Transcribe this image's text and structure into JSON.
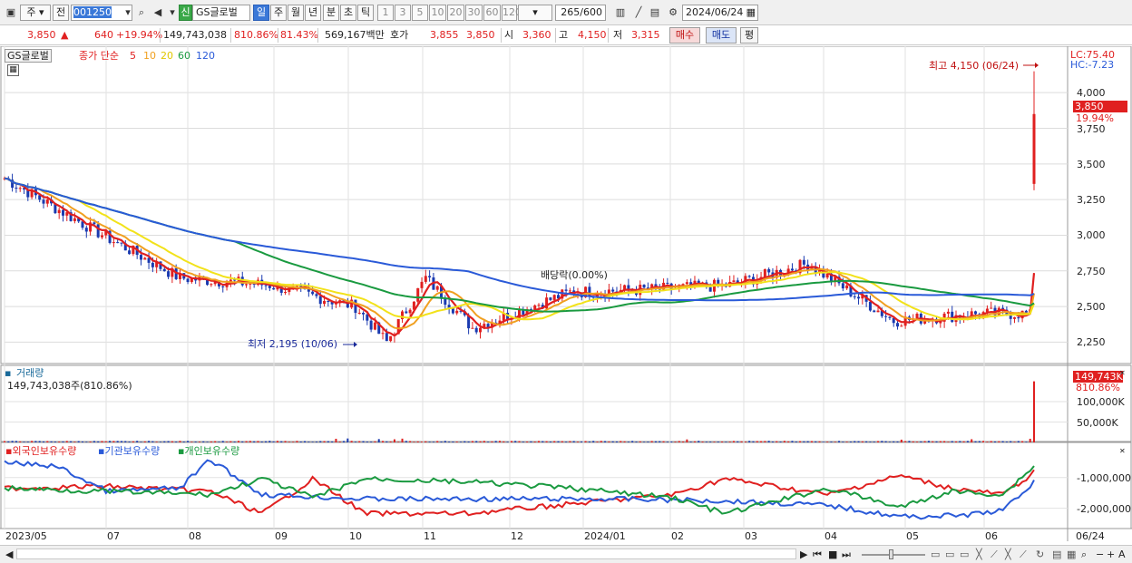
{
  "toolbar": {
    "period_menu": "주",
    "prev_button": "전",
    "code": "001250",
    "market_badge": "신",
    "name": "GS글로벌",
    "periods": [
      "일",
      "주",
      "월",
      "년",
      "분",
      "초",
      "틱"
    ],
    "active_period": "일",
    "minutes": [
      "1",
      "3",
      "5",
      "10",
      "20",
      "30",
      "60",
      "120"
    ],
    "count": "265",
    "count_total": "/600",
    "date": "2024/06/24"
  },
  "quote": {
    "price": "3,850",
    "change": "640",
    "change_pct": "+19.94%",
    "volume": "149,743,038",
    "volume_ratio": "810.86%",
    "strength": "81.43%",
    "amount": "569,167백만",
    "hoga_label": "호가",
    "ask": "3,855",
    "bid": "3,850",
    "open_label": "시",
    "open": "3,360",
    "high_label": "고",
    "high": "4,150",
    "low_label": "저",
    "low": "3,315",
    "buy_button": "매수",
    "sell_button": "매도",
    "avg_button": "평"
  },
  "price_panel": {
    "name_tag": "GS글로벌",
    "ma_title": "종가 단순",
    "ma_periods": [
      "5",
      "10",
      "20",
      "60",
      "120"
    ],
    "ma_colors": [
      "#e02020",
      "#f0a020",
      "#f2e21a",
      "#1a9a40",
      "#2a5ad8"
    ],
    "lc": "LC:75.40",
    "hc": "HC:-7.23",
    "price_tag": "3,850",
    "pct_tag": "19.94%",
    "high_note": "최고 4,150 (06/24)",
    "low_note": "최저 2,195 (10/06)",
    "dividend_note": "배당락(0.00%)"
  },
  "volume_panel": {
    "title": "거래량",
    "detail": "149,743,038주(810.86%)",
    "tag_value": "149,743K",
    "tag_pct": "810.86%"
  },
  "holding_panel": {
    "series": [
      {
        "name": "외국인보유수량",
        "color": "#e02020"
      },
      {
        "name": "기관보유수량",
        "color": "#2a5ad8"
      },
      {
        "name": "개인보유수량",
        "color": "#1a9a40"
      }
    ]
  },
  "chart_data": [
    {
      "type": "candlestick",
      "title": "GS글로벌",
      "x_range": [
        "2023/05",
        "2024/06/24"
      ],
      "x_ticks": [
        "2023/05",
        "07",
        "08",
        "09",
        "10",
        "11",
        "12",
        "2024/01",
        "02",
        "03",
        "04",
        "05",
        "06"
      ],
      "x_end_label": "06/24",
      "y_ticks": [
        "2,250",
        "2,500",
        "2,750",
        "3,000",
        "3,250",
        "3,500",
        "3,750",
        "4,000"
      ],
      "ylim": [
        2100,
        4300
      ],
      "grid": true,
      "close_series": [
        {
          "date": "2023/05",
          "value": 3400
        },
        {
          "date": "2023/06",
          "value": 3050
        },
        {
          "date": "2023/07",
          "value": 2700
        },
        {
          "date": "2023/08",
          "value": 2650
        },
        {
          "date": "2023/09",
          "value": 2500
        },
        {
          "date": "2023/10/06",
          "value": 2250
        },
        {
          "date": "2023/10",
          "value": 2700
        },
        {
          "date": "2023/11",
          "value": 2350
        },
        {
          "date": "2023/12",
          "value": 2600
        },
        {
          "date": "2024/01",
          "value": 2620
        },
        {
          "date": "2024/02",
          "value": 2650
        },
        {
          "date": "2024/03",
          "value": 2800
        },
        {
          "date": "2024/04",
          "value": 2400
        },
        {
          "date": "2024/05",
          "value": 2450
        },
        {
          "date": "2024/06",
          "value": 2450
        },
        {
          "date": "2024/06/24",
          "value": 3850
        }
      ],
      "last_candle": {
        "open": 3360,
        "high": 4150,
        "low": 3315,
        "close": 3850
      },
      "annotations": [
        "최고 4,150 (06/24)",
        "최저 2,195 (10/06)",
        "배당락(0.00%)"
      ]
    },
    {
      "type": "bar",
      "title": "거래량",
      "y_ticks": [
        "50,000K",
        "100,000K"
      ],
      "ylim": [
        0,
        160000
      ],
      "last_value_k": 149743
    },
    {
      "type": "line",
      "title": "외국인보유수량 / 기관보유수량 / 개인보유수량",
      "y_ticks": [
        "-1,000,000",
        "-2,000,000"
      ],
      "series": [
        {
          "name": "외국인보유수량",
          "color": "#e02020"
        },
        {
          "name": "기관보유수량",
          "color": "#2a5ad8"
        },
        {
          "name": "개인보유수량",
          "color": "#1a9a40"
        }
      ]
    }
  ],
  "scroll_controls": [
    "▶",
    "⏮",
    "■",
    "⏭"
  ]
}
